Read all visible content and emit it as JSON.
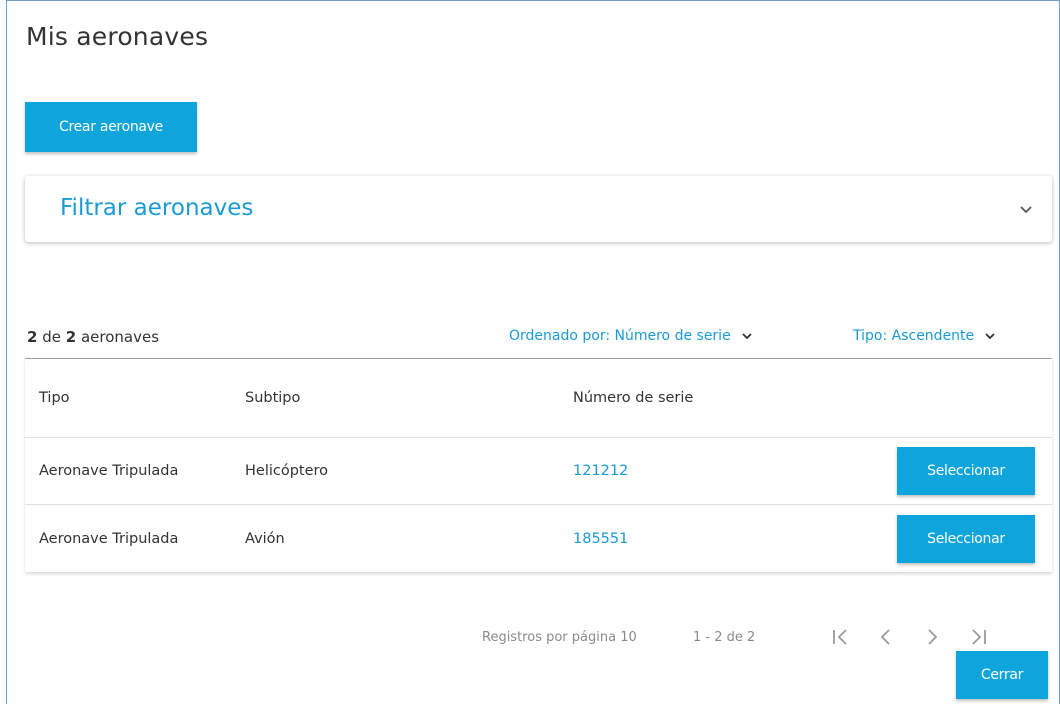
{
  "page": {
    "title": "Mis aeronaves"
  },
  "actions": {
    "create_label": "Crear aeronave",
    "close_label": "Cerrar"
  },
  "filter": {
    "title": "Filtrar aeronaves",
    "icon": "chevron-down-icon"
  },
  "summary": {
    "count": "2",
    "of": "de",
    "total": "2",
    "unit": "aeronaves"
  },
  "sort": {
    "field_label": "Ordenado por: Número de serie",
    "direction_label": "Tipo: Ascendente"
  },
  "table": {
    "columns": [
      "Tipo",
      "Subtipo",
      "Número de serie"
    ],
    "rows": [
      {
        "tipo": "Aeronave Tripulada",
        "subtipo": "Helicóptero",
        "numero_serie": "121212",
        "action": "Seleccionar"
      },
      {
        "tipo": "Aeronave Tripulada",
        "subtipo": "Avión",
        "numero_serie": "185551",
        "action": "Seleccionar"
      }
    ]
  },
  "pagination": {
    "rows_per_page_label": "Registros por página 10",
    "range_label": "1 - 2 de 2",
    "icons": [
      "first-page-icon",
      "prev-page-icon",
      "next-page-icon",
      "last-page-icon"
    ]
  },
  "colors": {
    "accent": "#0ea5dc",
    "link": "#1a9ad6",
    "frame_border": "#6f9fd0"
  }
}
